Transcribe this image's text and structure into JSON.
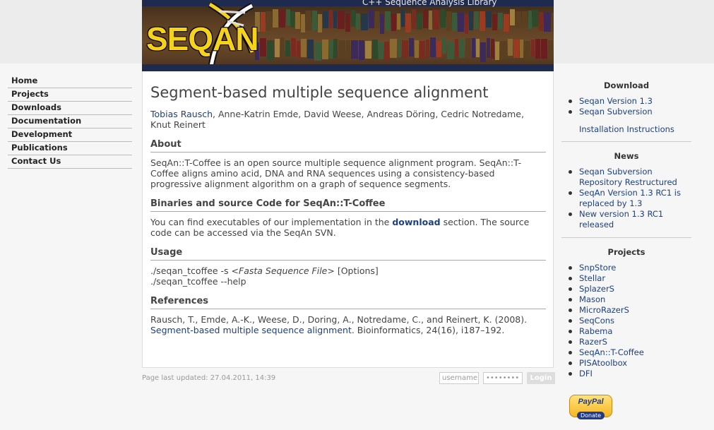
{
  "header": {
    "logo_text": "SEQAN",
    "tagline": "C++ Sequence Analysis Library"
  },
  "nav": {
    "items": [
      {
        "label": "Home"
      },
      {
        "label": "Projects"
      },
      {
        "label": "Downloads"
      },
      {
        "label": "Documentation"
      },
      {
        "label": "Development"
      },
      {
        "label": "Publications"
      },
      {
        "label": "Contact Us"
      }
    ]
  },
  "main": {
    "title": "Segment-based multiple sequence alignment",
    "authors_link": "Tobias Rausch",
    "authors_rest": ", Anne-Katrin Emde, David Weese, Andreas Döring, Cedric Notredame, Knut Reinert",
    "about": {
      "heading": "About",
      "text": "SeqAn::T-Coffee is an open source multiple sequence alignment program. SeqAn::T-Coffee aligns amino acid, DNA and RNA sequences using a consistency-based progressive alignment algorithm on a graph of sequence segments."
    },
    "binaries": {
      "heading": "Binaries and source Code for SeqAn::T-Coffee",
      "text_before": "You can find executables of our implementation in the ",
      "link": "download",
      "text_after": " section. The source code can be accessed via the SeqAn SVN."
    },
    "usage": {
      "heading": "Usage",
      "line1_prefix": "./seqan_tcoffee -s <",
      "line1_italic": "Fasta Sequence File",
      "line1_suffix": "> [Options]",
      "line2": "./seqan_tcoffee --help"
    },
    "references": {
      "heading": "References",
      "text_before": "Rausch, T., Emde, A.-K., Weese, D., Doring, A., Notredame, C., and Reinert, K. (2008). ",
      "link": "Segment-based multiple sequence alignment",
      "text_after": ". Bioinformatics, 24(16), i187–192."
    }
  },
  "footer": {
    "updated": "Page last updated: 27.04.2011, 14:39",
    "username_placeholder": "username",
    "password_placeholder": "••••••••",
    "login_label": "Login"
  },
  "sidebar": {
    "download": {
      "heading": "Download",
      "items": [
        {
          "label": "Seqan Version 1.3"
        },
        {
          "label": "Seqan Subversion"
        }
      ],
      "extra": "Installation Instructions"
    },
    "news": {
      "heading": "News",
      "items": [
        {
          "label": "Seqan Subversion Repository Restructured"
        },
        {
          "label": "SeqAn Version 1.3 RC1 is replaced by 1.3"
        },
        {
          "label": "New version 1.3 RC1 released"
        }
      ]
    },
    "projects": {
      "heading": "Projects",
      "items": [
        {
          "label": "SnpStore"
        },
        {
          "label": "Stellar"
        },
        {
          "label": "SplazerS"
        },
        {
          "label": "Mason"
        },
        {
          "label": "MicroRazerS"
        },
        {
          "label": "SeqCons"
        },
        {
          "label": "Rabema"
        },
        {
          "label": "RazerS"
        },
        {
          "label": "SeqAn::T-Coffee"
        },
        {
          "label": "PISAtoolbox"
        },
        {
          "label": "DFI"
        }
      ]
    },
    "paypal": {
      "brand": "PayPal",
      "label": "Donate"
    }
  },
  "colors": {
    "link": "#1d3f86",
    "logo": "#f7d21b",
    "banner_stripe": "#1e2a4e"
  }
}
